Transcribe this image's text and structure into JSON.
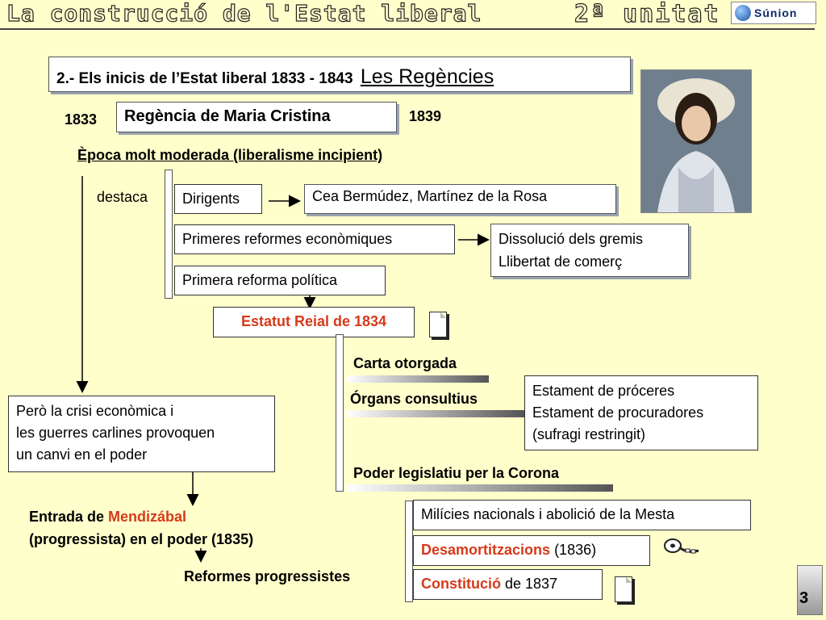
{
  "header": {
    "title": "La construcció de l'Estat liberal",
    "unit": "2ª unitat",
    "logo_text": "Súnion"
  },
  "main": {
    "section_title": "2.- Els inicis de l’Estat liberal 1833 - 1843",
    "section_subtitle": "Les Regències",
    "year_start": "1833",
    "regency": "Regència de Maria Cristina",
    "year_end": "1839",
    "epoch": "Època molt moderada (liberalisme incipient)",
    "destaca": "destaca",
    "dirigents": "Dirigents",
    "dirigents_names": "Cea Bermúdez, Martínez de la Rosa",
    "reformes_economiques": "Primeres reformes econòmiques",
    "reformes_economiques_result": [
      "Dissolució dels gremis",
      "Llibertat de comerç"
    ],
    "reforma_politica": "Primera reforma política",
    "estatut": "Estatut Reial de 1834",
    "carta": "Carta otorgada",
    "organs": "Órgans consultius",
    "estaments": [
      "Estament de próceres",
      "Estament de procuradores",
      "(sufragi restringit)"
    ],
    "poder_legislatiu": "Poder legislatiu per la Corona",
    "crisi": [
      "Però la crisi econòmica i",
      "les guerres carlines provoquen",
      "un canvi en el poder"
    ],
    "entrada_prefix": "Entrada de ",
    "entrada_name": "Mendizábal",
    "entrada_suffix": "(progressista) en el poder (1835)",
    "reformes_progressistes": "Reformes progressistes",
    "milicies": "Milícies nacionals i abolició de la Mesta",
    "desamortitzacions": "Desamortitzacions",
    "desamortitzacions_year": " (1836)",
    "constitucio": "Constitució",
    "constitucio_year": " de 1837",
    "page_number": "3"
  },
  "colors": {
    "background": "#ffffcc",
    "highlight": "#d63a1a",
    "shadow": "#9aa3b0"
  },
  "icons": [
    "document-icon",
    "film-reel-icon",
    "document-icon"
  ]
}
